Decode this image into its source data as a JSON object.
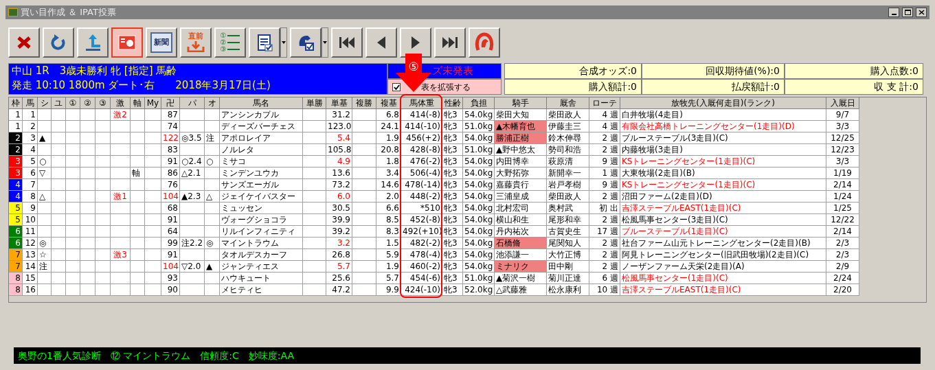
{
  "window": {
    "title": "買い目作成 ＆ IPAT投票"
  },
  "toolbar": [
    {
      "kind": "close",
      "selected": false
    },
    {
      "kind": "refresh",
      "selected": false
    },
    {
      "kind": "back",
      "selected": false
    },
    {
      "kind": "card",
      "selected": true
    },
    {
      "kind": "paper",
      "label": "新聞",
      "selected": false
    },
    {
      "kind": "download",
      "label": "直前",
      "selected": false
    },
    {
      "kind": "list",
      "marks": [
        "①",
        "②",
        "③"
      ],
      "selected": false
    },
    {
      "kind": "clipboard",
      "dropdown": true,
      "selected": false
    },
    {
      "kind": "horse-check",
      "dropdown": true,
      "selected": false
    },
    {
      "kind": "first",
      "selected": false
    },
    {
      "kind": "prev",
      "selected": false
    },
    {
      "kind": "next",
      "selected": false
    },
    {
      "kind": "last",
      "selected": false
    },
    {
      "kind": "horseshoe",
      "selected": false
    }
  ],
  "race": {
    "line1": "中山 1R　3歳未勝利 牝 [指定] 馬齢",
    "line2": "発走 10:10 1800m ダート･右　　2018年3月17日(土)",
    "odds_status": "ズ未発表",
    "expand": {
      "label": "表を拡張する",
      "checked": true
    }
  },
  "summary": [
    {
      "label": "合成オッズ:0"
    },
    {
      "label": "回収期待値(%):0"
    },
    {
      "label": "購入点数:0"
    },
    {
      "label": "購入額計:0"
    },
    {
      "label": "払戻額計:0"
    },
    {
      "label": "収 支 計:0"
    }
  ],
  "table": {
    "columns": [
      "枠",
      "馬",
      "シ",
      "ユ",
      "①",
      "②",
      "③",
      "激",
      "軸",
      "My",
      "卍",
      "パ",
      "オ",
      "馬名",
      "単勝",
      "単基",
      "複勝",
      "複基",
      "馬体重",
      "性齢",
      "負担",
      "騎手",
      "厩舎",
      "ローテ",
      "放牧先(入厩何走目)(ランク)",
      "入厩日"
    ],
    "rows": [
      {
        "waku": "1",
        "color": "#ffffff",
        "num": "1",
        "geki": "激2",
        "index": "87",
        "index_highlight": false,
        "name": "アンシンカプル",
        "win_base": "31.2",
        "win_base_highlight": false,
        "place_base": "6.8",
        "weight": "414(-8)",
        "sex_age": "牝3",
        "load": "54.0kg",
        "jockey": "柴田大知",
        "jockey_highlight": false,
        "trainer": "柴田政人",
        "rotation": "4 週",
        "farm": "白井牧場(4走目)",
        "farm_highlight": false,
        "arrival": "9/7"
      },
      {
        "waku": "1",
        "color": "#ffffff",
        "num": "2",
        "index": "74",
        "index_highlight": false,
        "name": "ディーズバーチェス",
        "win_base": "123.0",
        "win_base_highlight": false,
        "place_base": "24.1",
        "weight": "414(-10)",
        "sex_age": "牝3",
        "load": "51.0kg",
        "jockey": "▲木幡育也",
        "jockey_highlight": true,
        "trainer": "伊藤圭三",
        "rotation": "4 週",
        "farm": "有限会社高橋トレーニングセンター(1走目)(D)",
        "farm_highlight": true,
        "arrival": "3/3"
      },
      {
        "waku": "2",
        "color": "#000000",
        "num": "3",
        "shi": "▲",
        "index": "122",
        "index_highlight": true,
        "pa": "◎3.5",
        "o": "注",
        "name": "アポロレイア",
        "win_base": "5.4",
        "win_base_highlight": true,
        "place_base": "1.9",
        "weight": "456(+2)",
        "sex_age": "牝3",
        "load": "54.0kg",
        "jockey": "勝浦正樹",
        "jockey_highlight": true,
        "trainer": "鈴木伸尋",
        "rotation": "2 週",
        "farm": "ブルーステーブル(3走目)(C)",
        "farm_highlight": false,
        "arrival": "12/25"
      },
      {
        "waku": "2",
        "color": "#000000",
        "num": "4",
        "index": "83",
        "index_highlight": false,
        "name": "ノルレタ",
        "win_base": "105.8",
        "win_base_highlight": false,
        "place_base": "20.8",
        "weight": "428(-8)",
        "sex_age": "牝3",
        "load": "51.0kg",
        "jockey": "▲野中悠太",
        "jockey_highlight": false,
        "trainer": "勢司和浩",
        "rotation": "2 週",
        "farm": "内藤牧場(3走目)",
        "farm_highlight": false,
        "arrival": "12/23"
      },
      {
        "waku": "3",
        "color": "#ff0000",
        "num": "5",
        "shi": "○",
        "index": "91",
        "index_highlight": false,
        "pa": "○2.4",
        "o": "○",
        "name": "ミサコ",
        "win_base": "4.9",
        "win_base_highlight": true,
        "place_base": "1.8",
        "weight": "476(-2)",
        "sex_age": "牝3",
        "load": "54.0kg",
        "jockey": "内田博幸",
        "jockey_highlight": false,
        "trainer": "萩原清",
        "rotation": "9 週",
        "farm": "KSトレーニングセンター(1走目)(C)",
        "farm_highlight": true,
        "arrival": "3/3"
      },
      {
        "waku": "3",
        "color": "#ff0000",
        "num": "6",
        "shi": "▽",
        "jiku": "軸",
        "index": "86",
        "index_highlight": false,
        "pa": "△2.1",
        "name": "ミンデンユウカ",
        "win_base": "13.6",
        "win_base_highlight": false,
        "place_base": "3.4",
        "weight": "506(-4)",
        "sex_age": "牝3",
        "load": "54.0kg",
        "jockey": "大野拓弥",
        "jockey_highlight": false,
        "trainer": "新開幸一",
        "rotation": "1 週",
        "farm": "大東牧場(2走目)(B)",
        "farm_highlight": false,
        "arrival": "1/19"
      },
      {
        "waku": "4",
        "color": "#0000ff",
        "num": "7",
        "index": "76",
        "index_highlight": false,
        "name": "サンズエーガル",
        "win_base": "73.2",
        "win_base_highlight": false,
        "place_base": "14.6",
        "weight": "478(-14)",
        "sex_age": "牝3",
        "load": "54.0kg",
        "jockey": "嘉藤貴行",
        "jockey_highlight": false,
        "trainer": "岩戸孝樹",
        "rotation": "9 週",
        "farm": "KSトレーニングセンター(1走目)(C)",
        "farm_highlight": true,
        "arrival": "2/14"
      },
      {
        "waku": "4",
        "color": "#0000ff",
        "num": "8",
        "shi": "△",
        "geki": "激1",
        "index": "104",
        "index_highlight": true,
        "pa": "▲2.3",
        "o": "△",
        "name": "ジェイケイバスター",
        "win_base": "6.0",
        "win_base_highlight": true,
        "place_base": "2.0",
        "weight": "448(-2)",
        "sex_age": "牝3",
        "load": "54.0kg",
        "jockey": "三浦皇成",
        "jockey_highlight": false,
        "trainer": "柴田政人",
        "rotation": "2 週",
        "farm": "沼田ファーム(2走目)(D)",
        "farm_highlight": false,
        "arrival": "1/24"
      },
      {
        "waku": "5",
        "color": "#ffff00",
        "num": "9",
        "index": "68",
        "index_highlight": false,
        "name": "ミュッセン",
        "win_base": "30.5",
        "win_base_highlight": false,
        "place_base": "6.6",
        "weight": "*510",
        "sex_age": "牝3",
        "load": "54.0kg",
        "jockey": "北村宏司",
        "jockey_highlight": false,
        "trainer": "奥村武",
        "rotation": "初 出",
        "farm": "吉澤ステーブルEAST(1走目)(C)",
        "farm_highlight": true,
        "arrival": "1/25"
      },
      {
        "waku": "5",
        "color": "#ffff00",
        "num": "10",
        "index": "91",
        "index_highlight": false,
        "name": "ヴォーグショコラ",
        "win_base": "39.9",
        "win_base_highlight": false,
        "place_base": "8.5",
        "weight": "452(-8)",
        "sex_age": "牝3",
        "load": "54.0kg",
        "jockey": "横山和生",
        "jockey_highlight": false,
        "trainer": "尾形和幸",
        "rotation": "2 週",
        "farm": "松風馬事センター(3走目)(C)",
        "farm_highlight": false,
        "arrival": "12/22"
      },
      {
        "waku": "6",
        "color": "#008000",
        "num": "11",
        "index": "64",
        "index_highlight": false,
        "name": "リルインフィニティ",
        "win_base": "39.2",
        "win_base_highlight": false,
        "place_base": "8.3",
        "weight": "492(+10)",
        "sex_age": "牝3",
        "load": "54.0kg",
        "jockey": "丹内祐次",
        "jockey_highlight": false,
        "trainer": "古賀史生",
        "rotation": "17 週",
        "farm": "ブルーステーブル(1走目)(C)",
        "farm_highlight": true,
        "arrival": "2/14"
      },
      {
        "waku": "6",
        "color": "#008000",
        "num": "12",
        "shi": "◎",
        "index": "99",
        "index_highlight": false,
        "pa": "注2.2",
        "o": "◎",
        "name": "マイントラウム",
        "win_base": "3.2",
        "win_base_highlight": true,
        "place_base": "1.5",
        "weight": "482(-2)",
        "sex_age": "牝3",
        "load": "54.0kg",
        "jockey": "石橋脩",
        "jockey_highlight": true,
        "trainer": "尾関知人",
        "rotation": "2 週",
        "farm": "社台ファーム山元トレーニングセンター(2走目)(B)",
        "farm_highlight": false,
        "arrival": "2/3"
      },
      {
        "waku": "7",
        "color": "#ffa500",
        "num": "13",
        "shi": "☆",
        "geki": "激3",
        "index": "91",
        "index_highlight": false,
        "name": "タオルデスカーフ",
        "win_base": "26.8",
        "win_base_highlight": false,
        "place_base": "5.9",
        "weight": "478(-4)",
        "sex_age": "牝3",
        "load": "54.0kg",
        "jockey": "池添謙一",
        "jockey_highlight": false,
        "trainer": "大竹正博",
        "rotation": "2 週",
        "farm": "阿見トレーニングセンター(旧武田牧場)(2走目)(C)",
        "farm_highlight": false,
        "arrival": "2/3"
      },
      {
        "waku": "7",
        "color": "#ffa500",
        "num": "14",
        "shi": "注",
        "index": "104",
        "index_highlight": true,
        "pa": "▽2.0",
        "o": "▲",
        "name": "ジャンティエス",
        "win_base": "5.7",
        "win_base_highlight": true,
        "place_base": "1.9",
        "weight": "460(-2)",
        "sex_age": "牝3",
        "load": "54.0kg",
        "jockey": "ミナリク",
        "jockey_highlight": true,
        "trainer": "田中剛",
        "rotation": "2 週",
        "farm": "ノーザンファーム天栄(2走目)(A)",
        "farm_highlight": false,
        "arrival": "2/9"
      },
      {
        "waku": "8",
        "color": "#ffc0cb",
        "num": "15",
        "index": "93",
        "index_highlight": false,
        "name": "ハウキュート",
        "win_base": "25.6",
        "win_base_highlight": false,
        "place_base": "5.7",
        "weight": "454(-6)",
        "sex_age": "牝3",
        "load": "51.0kg",
        "jockey": "▲菊沢一樹",
        "jockey_highlight": false,
        "trainer": "菊川正達",
        "rotation": "6 週",
        "farm": "松風馬事センター(1走目)(C)",
        "farm_highlight": true,
        "arrival": "2/24"
      },
      {
        "waku": "8",
        "color": "#ffc0cb",
        "num": "16",
        "index": "90",
        "index_highlight": false,
        "name": "メヒティヒ",
        "win_base": "47.2",
        "win_base_highlight": false,
        "place_base": "9.9",
        "weight": "424(-10)",
        "sex_age": "牝3",
        "load": "52.0kg",
        "jockey": "△武藤雅",
        "jockey_highlight": false,
        "trainer": "松永康利",
        "rotation": "10 週",
        "farm": "吉澤ステーブルEAST(1走目)(C)",
        "farm_highlight": true,
        "arrival": "2/20"
      }
    ]
  },
  "annotation": {
    "number": "⑤"
  },
  "diagnosis": "奥野の1番人気診断　⑫ マイントラウム　信頼度:C　妙味度:AA"
}
